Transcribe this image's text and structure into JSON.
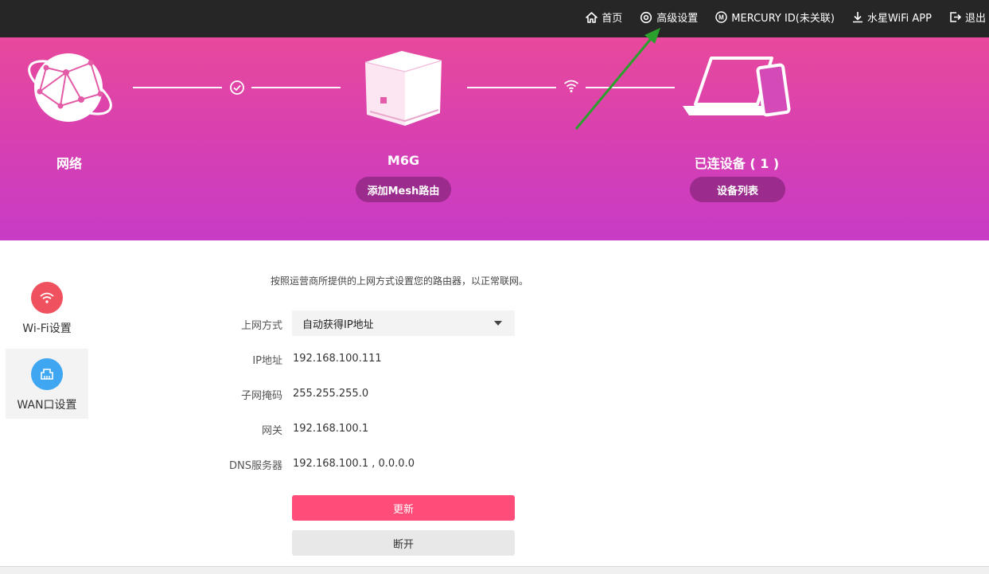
{
  "topnav": {
    "home": "首页",
    "advanced": "高级设置",
    "mercury_id": "MERCURY ID(未关联)",
    "app": "水星WiFi APP",
    "logout": "退出"
  },
  "hero": {
    "network_label": "网络",
    "router_label": "M6G",
    "router_button": "添加Mesh路由",
    "devices_label": "已连设备 ( 1 )",
    "devices_button": "设备列表"
  },
  "sidebar": {
    "items": [
      {
        "label": "Wi-Fi设置",
        "icon": "wifi-icon",
        "color": "#f0515e",
        "active": false
      },
      {
        "label": "WAN口设置",
        "icon": "wan-port-icon",
        "color": "#3fa6f2",
        "active": true
      }
    ]
  },
  "form": {
    "intro": "按照运营商所提供的上网方式设置您的路由器，以正常联网。",
    "connection_type_label": "上网方式",
    "connection_type_value": "自动获得IP地址",
    "ip_label": "IP地址",
    "ip_value": "192.168.100.111",
    "mask_label": "子网掩码",
    "mask_value": "255.255.255.0",
    "gateway_label": "网关",
    "gateway_value": "192.168.100.1",
    "dns_label": "DNS服务器",
    "dns_value": "192.168.100.1 , 0.0.0.0",
    "renew_button": "更新",
    "disconnect_button": "断开"
  },
  "colors": {
    "topbar": "#262626",
    "hero_top": "#e8499c",
    "hero_bottom": "#c73cc6",
    "primary_button": "#ff4d7a",
    "pill": "#9b2b8c",
    "annotation_arrow": "#2ca02c"
  }
}
